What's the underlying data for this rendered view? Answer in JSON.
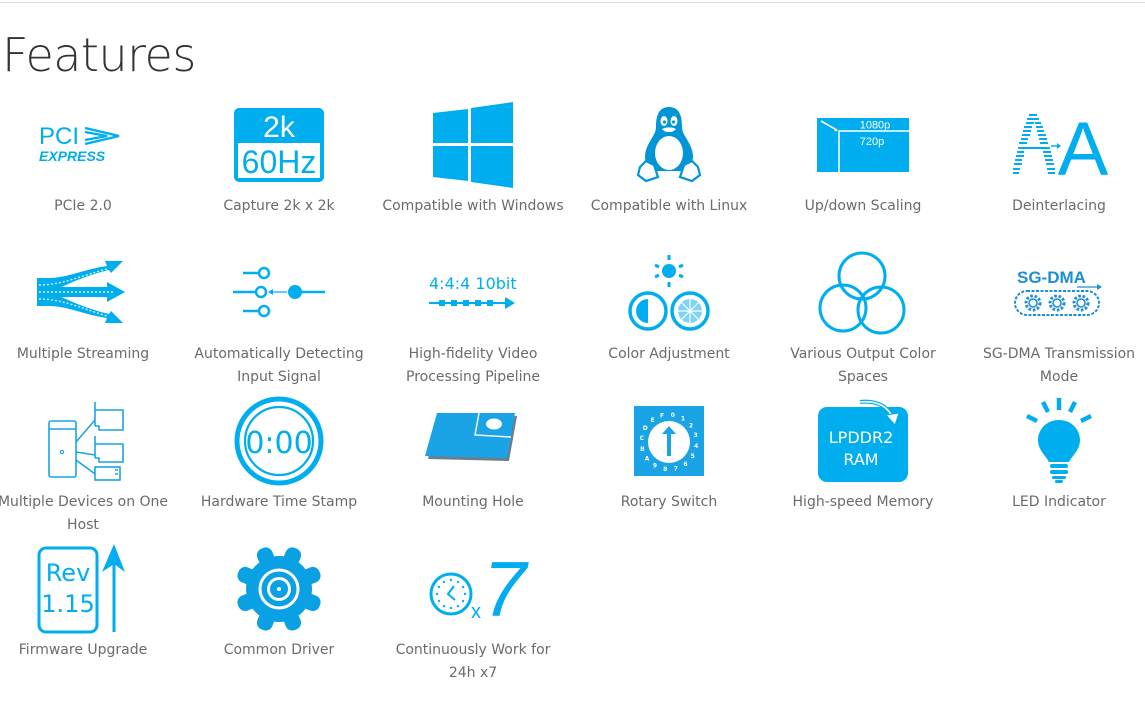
{
  "page": {
    "title": "Features"
  },
  "colors": {
    "accent": "#00aeef",
    "text": "#6b6b6b",
    "heading": "#333333",
    "rule": "#dddddd"
  },
  "features": [
    {
      "label": "PCIe 2.0",
      "icon": "pcie-logo-icon",
      "icon_text": [
        "PCI",
        "EXPRESS"
      ]
    },
    {
      "label": "Capture 2k x 2k",
      "icon": "resolution-2k-60hz-icon",
      "icon_text": [
        "2k",
        "60Hz"
      ]
    },
    {
      "label": "Compatible with Windows",
      "icon": "windows-logo-icon"
    },
    {
      "label": "Compatible with Linux",
      "icon": "linux-tux-icon"
    },
    {
      "label": "Up/down Scaling",
      "icon": "scaling-icon",
      "icon_text": [
        "1080p",
        "720p"
      ]
    },
    {
      "label": "Deinterlacing",
      "icon": "deinterlacing-icon",
      "icon_text": [
        "A",
        "A"
      ]
    },
    {
      "label": "Multiple Streaming",
      "icon": "multi-stream-arrows-icon"
    },
    {
      "label": "Automatically Detecting Input Signal",
      "icon": "input-switch-icon"
    },
    {
      "label": "High-fidelity Video Processing Pipeline",
      "icon": "pipeline-icon",
      "icon_text": [
        "4:4:4 10bit"
      ]
    },
    {
      "label": "Color Adjustment",
      "icon": "color-adjust-icon"
    },
    {
      "label": "Various Output Color Spaces",
      "icon": "color-spaces-circles-icon"
    },
    {
      "label": "SG-DMA Transmission Mode",
      "icon": "sg-dma-gears-icon",
      "icon_text": [
        "SG-DMA"
      ]
    },
    {
      "label": "Multiple Devices on One Host",
      "icon": "multi-device-host-icon"
    },
    {
      "label": "Hardware Time Stamp",
      "icon": "timestamp-icon",
      "icon_text": [
        "0:00"
      ]
    },
    {
      "label": "Mounting Hole",
      "icon": "mounting-hole-icon"
    },
    {
      "label": "Rotary Switch",
      "icon": "rotary-switch-icon",
      "icon_text": [
        "0",
        "1",
        "2",
        "3",
        "4",
        "5",
        "6",
        "7",
        "8",
        "9",
        "A",
        "B",
        "C",
        "D",
        "E",
        "F"
      ]
    },
    {
      "label": "High-speed Memory",
      "icon": "memory-chip-icon",
      "icon_text": [
        "LPDDR2",
        "RAM"
      ]
    },
    {
      "label": "LED Indicator",
      "icon": "lightbulb-icon"
    },
    {
      "label": "Firmware Upgrade",
      "icon": "firmware-upgrade-icon",
      "icon_text": [
        "Rev",
        "1.15"
      ]
    },
    {
      "label": "Common Driver",
      "icon": "gear-icon"
    },
    {
      "label": "Continuously Work for 24h x7",
      "icon": "clock-24x7-icon",
      "icon_text": [
        "x",
        "7"
      ]
    }
  ]
}
